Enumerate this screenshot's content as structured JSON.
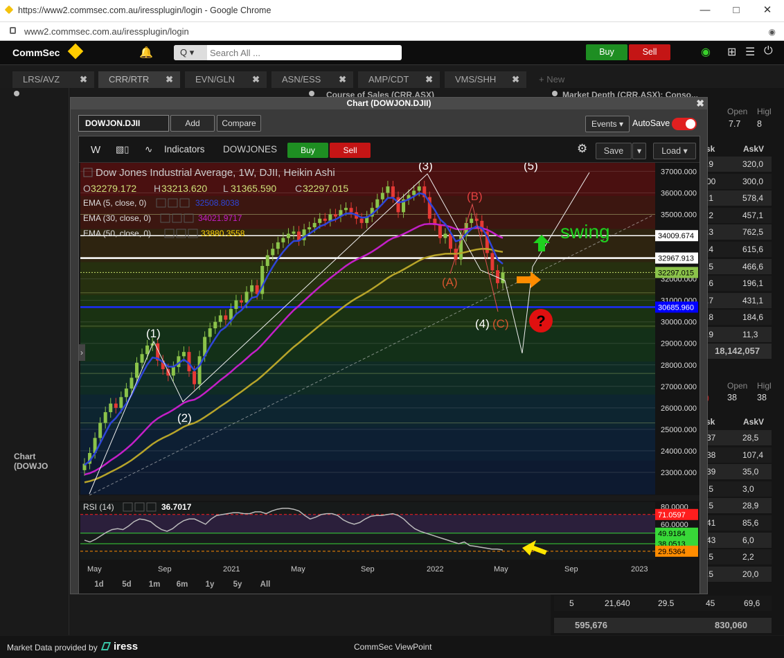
{
  "browser": {
    "title": "https://www2.commsec.com.au/iressplugin/login - Google Chrome",
    "url": "www2.commsec.com.au/iressplugin/login",
    "minimize": "—",
    "maximize": "□",
    "close": "✕"
  },
  "header": {
    "logo": "CommSec",
    "search_button": "Q ▾",
    "search_placeholder": "Search All ...",
    "buy": "Buy",
    "sell": "Sell"
  },
  "tabs": [
    {
      "label": "LRS/AVZ"
    },
    {
      "label": "CRR/RTR"
    },
    {
      "label": "EVN/GLN"
    },
    {
      "label": "ASN/ESS"
    },
    {
      "label": "AMP/CDT"
    },
    {
      "label": "VMS/SHH"
    }
  ],
  "tab_close": "✖",
  "tab_new": "+ New",
  "side_label": "Chart (DOWJO",
  "panels": {
    "course_of_sales": "Course of Sales (CRR.ASX)",
    "market_depth": "Market Depth (CRR.ASX): Conso..."
  },
  "market_depth": {
    "head1": {
      "open_label": "Open",
      "high_label": "Higl",
      "open": "7.7",
      "high": "8"
    },
    "head2": {
      "open_label": "Open",
      "high_label": "Higl",
      "open": "38",
      "high": "38"
    },
    "col_sk": "sk",
    "col_askv": "AskV",
    "rows1": [
      {
        "a": ".9",
        "b": "320,0"
      },
      {
        "a": "00",
        "b": "300,0"
      },
      {
        "a": ".1",
        "b": "578,4"
      },
      {
        "a": ".2",
        "b": "457,1"
      },
      {
        "a": ".3",
        "b": "762,5"
      },
      {
        "a": ".4",
        "b": "615,6"
      },
      {
        "a": ".5",
        "b": "466,6"
      },
      {
        "a": ".6",
        "b": "196,1"
      },
      {
        "a": ".7",
        "b": "431,1"
      },
      {
        "a": ".8",
        "b": "184,6"
      },
      {
        "a": ".9",
        "b": "11,3"
      }
    ],
    "total1": "18,142,057",
    "rows2": [
      {
        "a": "37",
        "b": "28,5"
      },
      {
        "a": "38",
        "b": "107,4"
      },
      {
        "a": "39",
        "b": "35,0"
      },
      {
        "a": ".5",
        "b": "3,0"
      },
      {
        "a": ".5",
        "b": "28,9"
      },
      {
        "a": "41",
        "b": "85,6"
      },
      {
        "a": "43",
        "b": "6,0"
      },
      {
        "a": ".5",
        "b": "2,2"
      },
      {
        "a": ".5",
        "b": "20,0"
      }
    ],
    "last_row": {
      "a": "5",
      "b": "21,640",
      "c": "29.5",
      "d": "45",
      "e": "69,6"
    },
    "totals": {
      "left": "595,676",
      "right": "830,060"
    }
  },
  "footer": {
    "provided": "Market Data provided by",
    "brand": "iress",
    "center": "CommSec ViewPoint"
  },
  "modal": {
    "title": "Chart (DOWJON.DJII)",
    "close": "✖",
    "symbol": "DOWJON.DJII",
    "add": "Add",
    "compare": "Compare",
    "events": "Events ▾",
    "autosave": "AutoSave"
  },
  "chart_toolbar": {
    "interval": "W",
    "indicators": "Indicators",
    "symbol_name": "DOWJONES",
    "buy": "Buy",
    "sell": "Sell",
    "save": "Save",
    "save_menu": "▾",
    "load": "Load ▾"
  },
  "range_buttons": [
    "1d",
    "5d",
    "1m",
    "6m",
    "1y",
    "5y",
    "All"
  ],
  "chart_data": {
    "type": "line",
    "title": "Dow Jones Industrial Average, 1W, DJII, Heikin Ashi",
    "ohlc": {
      "O": "32279.172",
      "H": "33213.620",
      "L": "31365.590",
      "C": "32297.015"
    },
    "ohlc_labels": {
      "o": "O",
      "h": "H",
      "l": "L",
      "c": "C"
    },
    "indicators": [
      {
        "label": "EMA (5, close, 0)",
        "value": "32508.8038",
        "color": "#2f45d8"
      },
      {
        "label": "EMA (30, close, 0)",
        "value": "34021.9717",
        "color": "#c41fc8"
      },
      {
        "label": "EMA (50, close, 0)",
        "value": "33880.3558",
        "color": "#ffd700"
      }
    ],
    "ylim": [
      22000,
      37400
    ],
    "y_ticks": [
      "37000.000",
      "36000.000",
      "35000.000",
      "34000.000",
      "33000.000",
      "32000.000",
      "31000.000",
      "30000.000",
      "29000.000",
      "28000.000",
      "27000.000",
      "26000.000",
      "25000.000",
      "24000.000",
      "23000.000"
    ],
    "x_ticks": [
      "May",
      "Sep",
      "2021",
      "May",
      "Sep",
      "2022",
      "May",
      "Sep",
      "2023"
    ],
    "price_labels": [
      {
        "text": "34009.674",
        "value": 34009.674,
        "bg": "#ffffff",
        "fg": "#000000"
      },
      {
        "text": "32967.913",
        "value": 32967.913,
        "bg": "#ffffff",
        "fg": "#000000"
      },
      {
        "text": "32297.015",
        "value": 32297.015,
        "bg": "#8bc34a",
        "fg": "#000000"
      },
      {
        "text": "30685.960",
        "value": 30685.96,
        "bg": "#0000ff",
        "fg": "#ffffff"
      }
    ],
    "close_series": [
      23400,
      23900,
      24600,
      25300,
      25800,
      26200,
      26000,
      26500,
      26900,
      27400,
      28100,
      28500,
      28900,
      29000,
      28200,
      27800,
      27500,
      27900,
      28400,
      28600,
      27700,
      27100,
      28400,
      29300,
      29700,
      30000,
      30300,
      30100,
      30600,
      31000,
      30900,
      31400,
      31700,
      31300,
      32600,
      33100,
      33400,
      33700,
      33900,
      34100,
      34200,
      33800,
      34300,
      34400,
      34600,
      34800,
      34700,
      35000,
      34900,
      35200,
      35300,
      35100,
      34800,
      34600,
      34900,
      35300,
      35700,
      36000,
      36300,
      35800,
      35100,
      35700,
      35900,
      36100,
      36300,
      35800,
      34800,
      34500,
      33900,
      34100,
      33400,
      32900,
      34000,
      34600,
      34800,
      34700,
      34200,
      33200,
      32400,
      31800,
      32300
    ],
    "rsi": {
      "label": "RSI (14)",
      "value": "36.7017",
      "ylim": [
        20,
        85
      ],
      "y_ticks": [
        "80.0000",
        "60.0000"
      ],
      "levels": [
        {
          "text": "71.0597",
          "value": 71.0597,
          "bg": "#ff1e1e",
          "fg": "#ffffff"
        },
        {
          "text": "49.9184",
          "value": 49.9184,
          "bg": "#38d838",
          "fg": "#000000"
        },
        {
          "text": "38.0513",
          "value": 38.0513,
          "bg": "#38d838",
          "fg": "#000000"
        },
        {
          "text": "29.5364",
          "value": 29.5364,
          "bg": "#ff8c00",
          "fg": "#000000"
        }
      ],
      "series": [
        42,
        40,
        43,
        47,
        51,
        54,
        55,
        54,
        58,
        63,
        66,
        65,
        63,
        58,
        54,
        52,
        55,
        60,
        64,
        66,
        66,
        63,
        60,
        66,
        70,
        71,
        72,
        73,
        73,
        72,
        72,
        74,
        74,
        72,
        75,
        77,
        78,
        78,
        77,
        75,
        70,
        66,
        68,
        71,
        72,
        72,
        70,
        65,
        62,
        60,
        62,
        66,
        69,
        70,
        70,
        71,
        72,
        70,
        66,
        60,
        55,
        52,
        50,
        48,
        46,
        44,
        42,
        40,
        38,
        40,
        36,
        35,
        34,
        33,
        32,
        32,
        31
      ]
    },
    "wave_labels": {
      "w1": "(1)",
      "w2": "(2)",
      "w3": "(3)",
      "w4": "(4)",
      "w5": "(5)",
      "a": "(A)",
      "b": "(B)",
      "c": "(C)"
    },
    "annotation": "swing",
    "question": "?"
  }
}
